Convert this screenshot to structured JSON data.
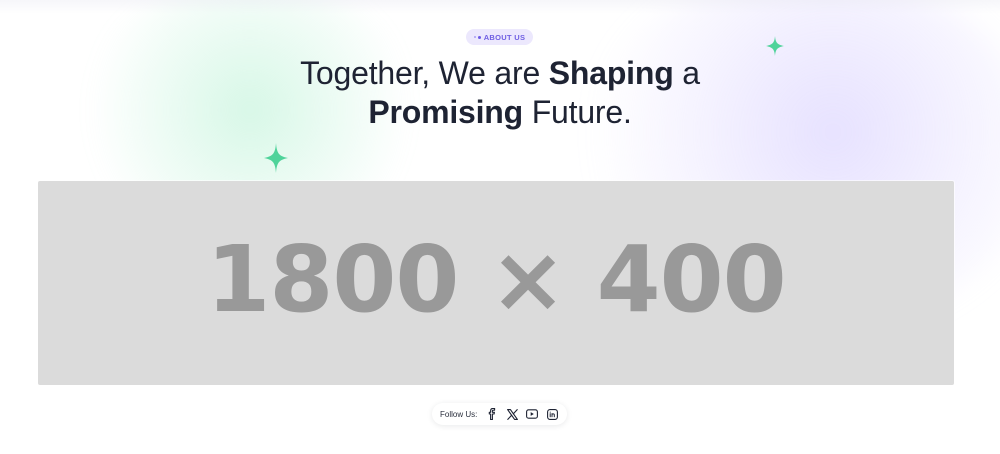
{
  "badge": {
    "label": "ABOUT US",
    "icon": "dots-icon"
  },
  "heading": {
    "line1_pre": "Together, We are ",
    "line1_bold": "Shaping",
    "line1_post": " a",
    "line2_bold": "Promising",
    "line2_post": " Future."
  },
  "placeholder": {
    "text": "1800 × 400"
  },
  "follow": {
    "label": "Follow Us:",
    "links": [
      {
        "name": "facebook",
        "icon": "facebook-icon"
      },
      {
        "name": "x",
        "icon": "x-icon"
      },
      {
        "name": "youtube",
        "icon": "youtube-icon"
      },
      {
        "name": "linkedin",
        "icon": "linkedin-icon"
      }
    ]
  },
  "colors": {
    "accent_purple": "#6f5fe3",
    "badge_bg": "#ece8fd",
    "sparkle_green": "#4fd39a",
    "heading_text": "#1e2333",
    "placeholder_bg": "#dbdbdb",
    "placeholder_text": "#999999"
  }
}
